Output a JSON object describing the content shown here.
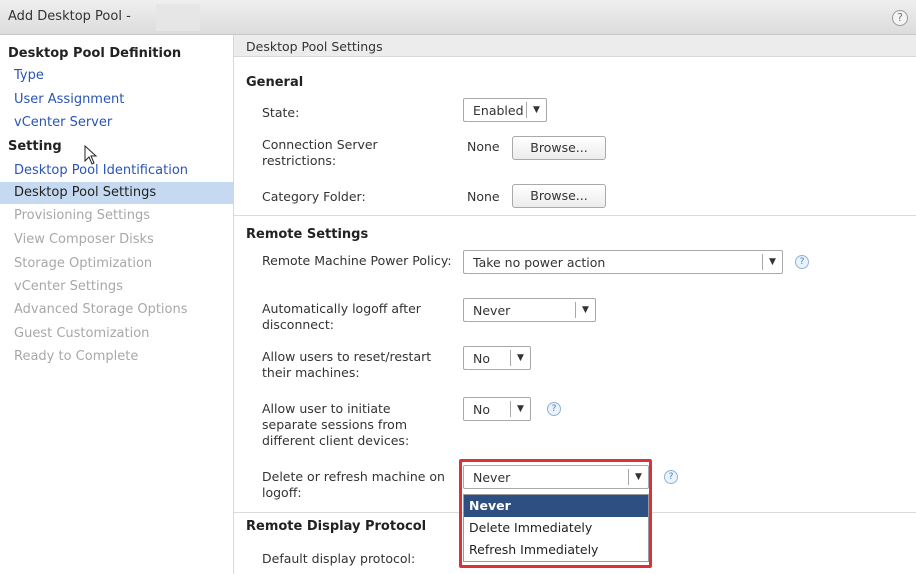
{
  "window": {
    "title": "Add Desktop Pool -",
    "help": "?"
  },
  "sidebar": {
    "sections": [
      {
        "label": "Desktop Pool Definition"
      },
      {
        "label": "Setting"
      }
    ],
    "items": [
      {
        "label": "Type",
        "state": "link"
      },
      {
        "label": "User Assignment",
        "state": "link"
      },
      {
        "label": "vCenter Server",
        "state": "link"
      },
      {
        "label": "Desktop Pool Identification",
        "state": "link"
      },
      {
        "label": "Desktop Pool Settings",
        "state": "active"
      },
      {
        "label": "Provisioning Settings",
        "state": "disabled"
      },
      {
        "label": "View Composer Disks",
        "state": "disabled"
      },
      {
        "label": "Storage Optimization",
        "state": "disabled"
      },
      {
        "label": "vCenter Settings",
        "state": "disabled"
      },
      {
        "label": "Advanced Storage Options",
        "state": "disabled"
      },
      {
        "label": "Guest Customization",
        "state": "disabled"
      },
      {
        "label": "Ready to Complete",
        "state": "disabled"
      }
    ]
  },
  "content": {
    "header": "Desktop Pool Settings",
    "general": {
      "title": "General",
      "state_label": "State:",
      "state_value": "Enabled",
      "conn_label": "Connection Server restrictions:",
      "conn_value": "None",
      "conn_browse": "Browse...",
      "cat_label": "Category Folder:",
      "cat_value": "None",
      "cat_browse": "Browse..."
    },
    "remote": {
      "title": "Remote Settings",
      "power_label": "Remote Machine Power Policy:",
      "power_value": "Take no power action",
      "logoff_label": "Automatically logoff after disconnect:",
      "logoff_value": "Never",
      "reset_label": "Allow users to reset/restart their machines:",
      "reset_value": "No",
      "sessions_label": "Allow user to initiate separate sessions from different client devices:",
      "sessions_value": "No",
      "delete_label": "Delete or refresh machine on logoff:",
      "delete_value": "Never",
      "delete_options": [
        "Never",
        "Delete Immediately",
        "Refresh Immediately"
      ]
    },
    "display": {
      "title": "Remote Display Protocol",
      "default_label": "Default display protocol:"
    }
  },
  "colors": {
    "highlight": "#d9333a",
    "link": "#2a55b4",
    "active_bg": "#c5d9f1",
    "dropdown_selected": "#2d4f82"
  }
}
